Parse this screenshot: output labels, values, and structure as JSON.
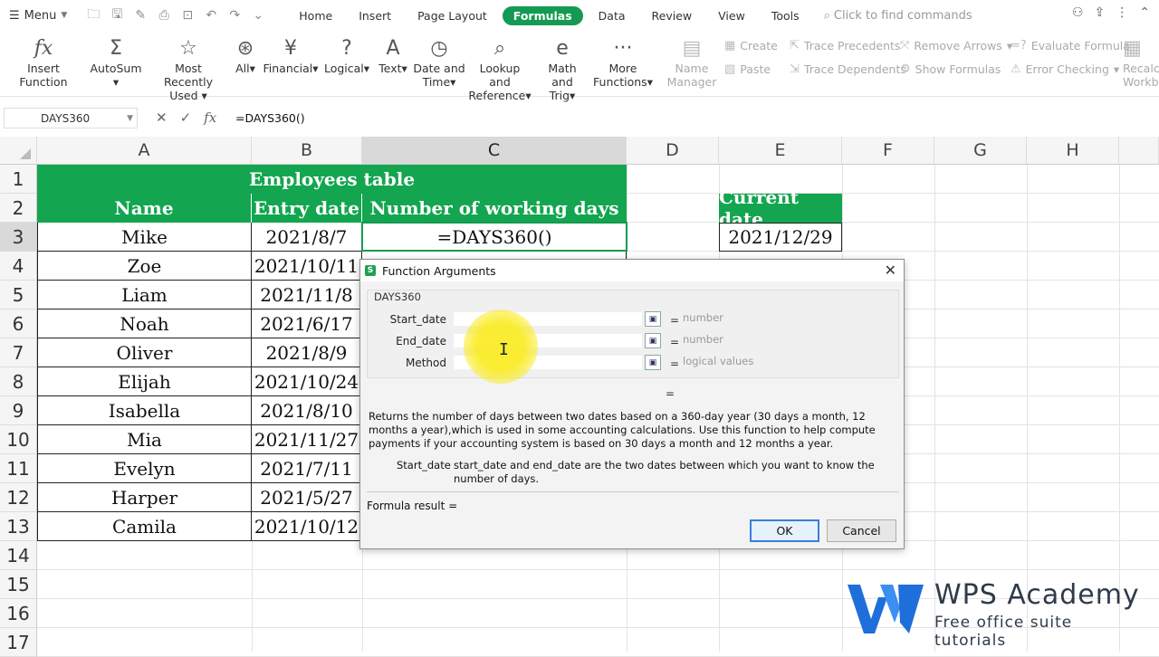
{
  "menubar": {
    "menu_label": "Menu",
    "tabs": [
      "Home",
      "Insert",
      "Page Layout",
      "Formulas",
      "Data",
      "Review",
      "View",
      "Tools"
    ],
    "active_tab": "Formulas",
    "search_placeholder": "Click to find commands"
  },
  "ribbon": {
    "buttons": [
      {
        "label1": "Insert Function",
        "label2": "",
        "icon": "fx-icon"
      },
      {
        "label1": "AutoSum",
        "label2": "",
        "icon": "sigma-icon"
      },
      {
        "label1": "Most Recently",
        "label2": "Used",
        "icon": "star-icon"
      },
      {
        "label1": "All",
        "label2": "",
        "icon": "asterisk-icon"
      },
      {
        "label1": "Financial",
        "label2": "",
        "icon": "yen-icon"
      },
      {
        "label1": "Logical",
        "label2": "",
        "icon": "question-icon"
      },
      {
        "label1": "Text",
        "label2": "",
        "icon": "text-a-icon"
      },
      {
        "label1": "Date and",
        "label2": "Time",
        "icon": "clock-icon"
      },
      {
        "label1": "Lookup and",
        "label2": "Reference",
        "icon": "magnifier-icon"
      },
      {
        "label1": "Math and",
        "label2": "Trig",
        "icon": "math-e-icon"
      },
      {
        "label1": "More",
        "label2": "Functions",
        "icon": "dots-icon"
      },
      {
        "label1": "Name",
        "label2": "Manager",
        "icon": "name-manager-icon"
      },
      {
        "label1": "Recalc",
        "label2": "Workb",
        "icon": "recalc-icon"
      }
    ],
    "small": {
      "create": "Create",
      "paste": "Paste",
      "trace_precedents": "Trace Precedents",
      "trace_dependents": "Trace Dependents",
      "remove_arrows": "Remove Arrows",
      "show_formulas": "Show Formulas",
      "evaluate_formula": "Evaluate Formula",
      "error_checking": "Error Checking"
    }
  },
  "formula_bar": {
    "name_box": "DAYS360",
    "formula": "=DAYS360()"
  },
  "columns": [
    "A",
    "B",
    "C",
    "D",
    "E",
    "F",
    "G",
    "H"
  ],
  "rows": [
    "1",
    "2",
    "3",
    "4",
    "5",
    "6",
    "7",
    "8",
    "9",
    "10",
    "11",
    "12",
    "13",
    "14",
    "15",
    "16",
    "17"
  ],
  "sheet": {
    "title": "Employees table",
    "headers": {
      "name": "Name",
      "entry": "Entry date",
      "working": "Number of working days",
      "current": "Current date"
    },
    "current_date": "2021/12/29",
    "active_cell_text": "=DAYS360()",
    "employees": [
      {
        "name": "Mike",
        "date": "2021/8/7"
      },
      {
        "name": "Zoe",
        "date": "2021/10/11"
      },
      {
        "name": "Liam",
        "date": "2021/11/8"
      },
      {
        "name": "Noah",
        "date": "2021/6/17"
      },
      {
        "name": "Oliver",
        "date": "2021/8/9"
      },
      {
        "name": "Elijah",
        "date": "2021/10/24"
      },
      {
        "name": "Isabella",
        "date": "2021/8/10"
      },
      {
        "name": "Mia",
        "date": "2021/11/27"
      },
      {
        "name": "Evelyn",
        "date": "2021/7/11"
      },
      {
        "name": "Harper",
        "date": "2021/5/27"
      },
      {
        "name": "Camila",
        "date": "2021/10/12"
      }
    ]
  },
  "dialog": {
    "title": "Function Arguments",
    "function_name": "DAYS360",
    "args": [
      {
        "label": "Start_date",
        "hint": "number"
      },
      {
        "label": "End_date",
        "hint": "number"
      },
      {
        "label": "Method",
        "hint": "logical values"
      }
    ],
    "equals": "=",
    "description": "Returns the number of days between two dates based on a 360-day year (30 days a month, 12 months a year),which is used in some accounting calculations. Use this function to help compute payments if your accounting system is based on 30 days a month and 12 months a year.",
    "arg_help_label": "Start_date",
    "arg_help_text": "start_date and end_date are the two dates between which you want to know the number of days.",
    "formula_result_label": "Formula result  =",
    "ok": "OK",
    "cancel": "Cancel"
  },
  "watermark": {
    "title": "WPS Academy",
    "subtitle": "Free office suite tutorials"
  },
  "colors": {
    "accent": "#149a52",
    "header_green": "#13a54f"
  }
}
